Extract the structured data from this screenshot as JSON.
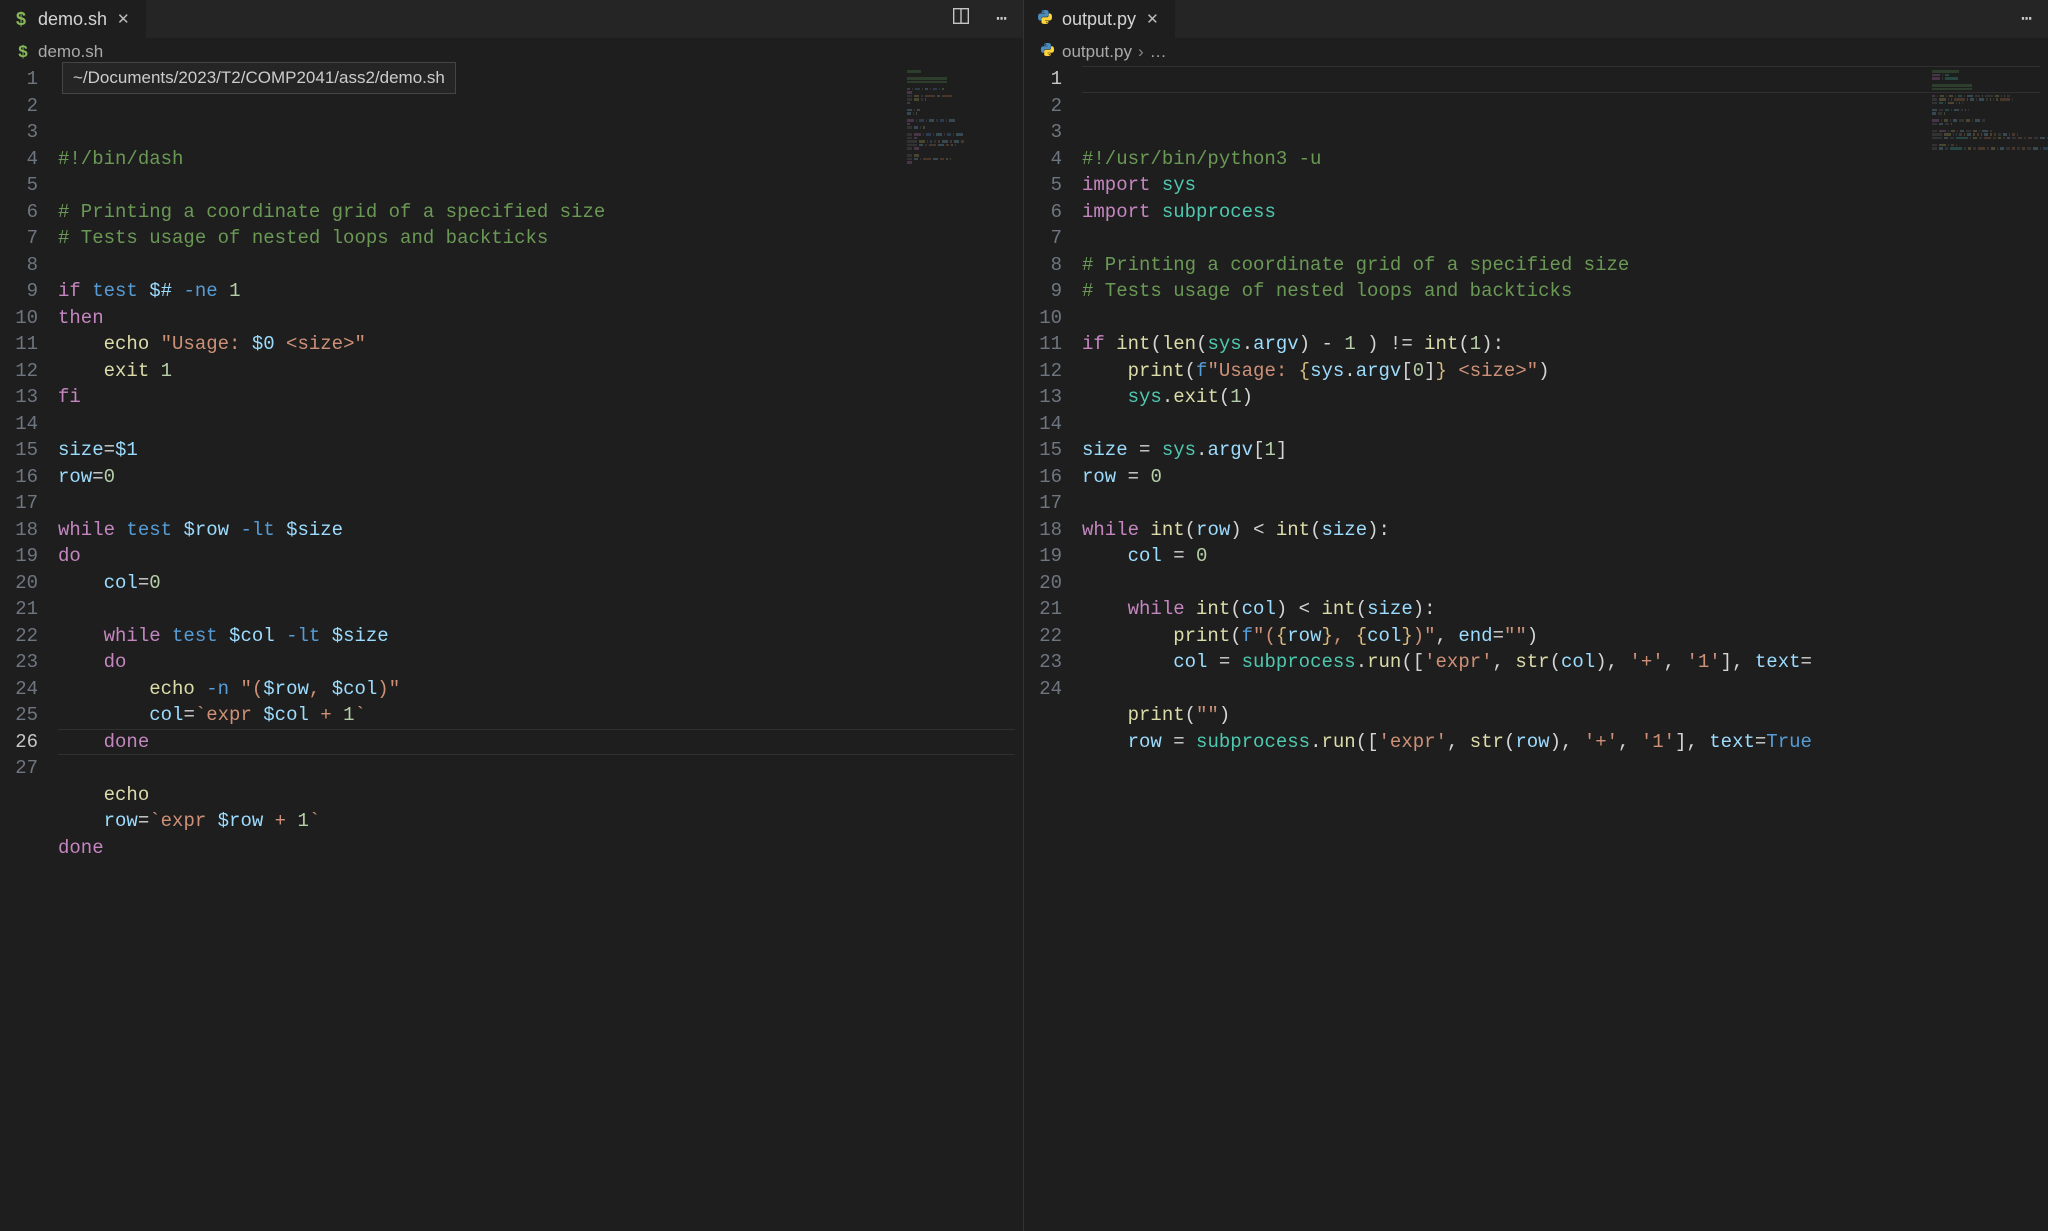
{
  "left": {
    "tab": {
      "filename": "demo.sh",
      "icon": "$"
    },
    "breadcrumb": {
      "filename": "demo.sh",
      "icon": "$"
    },
    "tooltip": "~/Documents/2023/T2/COMP2041/ass2/demo.sh",
    "active_line": 26,
    "code": [
      [
        {
          "c": "com",
          "t": "#!/bin/dash"
        }
      ],
      [],
      [
        {
          "c": "com",
          "t": "# Printing a coordinate grid of a specified size"
        }
      ],
      [
        {
          "c": "com",
          "t": "# Tests usage of nested loops and backticks"
        }
      ],
      [],
      [
        {
          "c": "kw",
          "t": "if"
        },
        {
          "c": "op",
          "t": " "
        },
        {
          "c": "cmd",
          "t": "test"
        },
        {
          "c": "op",
          "t": " "
        },
        {
          "c": "var",
          "t": "$#"
        },
        {
          "c": "op",
          "t": " "
        },
        {
          "c": "flag",
          "t": "-ne"
        },
        {
          "c": "op",
          "t": " "
        },
        {
          "c": "num",
          "t": "1"
        }
      ],
      [
        {
          "c": "kw",
          "t": "then"
        }
      ],
      [
        {
          "c": "op",
          "t": "    "
        },
        {
          "c": "fn",
          "t": "echo"
        },
        {
          "c": "op",
          "t": " "
        },
        {
          "c": "str",
          "t": "\"Usage: "
        },
        {
          "c": "var",
          "t": "$0"
        },
        {
          "c": "str",
          "t": " <size>\""
        }
      ],
      [
        {
          "c": "op",
          "t": "    "
        },
        {
          "c": "fn",
          "t": "exit"
        },
        {
          "c": "op",
          "t": " "
        },
        {
          "c": "num",
          "t": "1"
        }
      ],
      [
        {
          "c": "kw",
          "t": "fi"
        }
      ],
      [],
      [
        {
          "c": "var",
          "t": "size"
        },
        {
          "c": "op",
          "t": "="
        },
        {
          "c": "var",
          "t": "$1"
        }
      ],
      [
        {
          "c": "var",
          "t": "row"
        },
        {
          "c": "op",
          "t": "="
        },
        {
          "c": "num",
          "t": "0"
        }
      ],
      [],
      [
        {
          "c": "kw",
          "t": "while"
        },
        {
          "c": "op",
          "t": " "
        },
        {
          "c": "cmd",
          "t": "test"
        },
        {
          "c": "op",
          "t": " "
        },
        {
          "c": "var",
          "t": "$row"
        },
        {
          "c": "op",
          "t": " "
        },
        {
          "c": "flag",
          "t": "-lt"
        },
        {
          "c": "op",
          "t": " "
        },
        {
          "c": "var",
          "t": "$size"
        }
      ],
      [
        {
          "c": "kw",
          "t": "do"
        }
      ],
      [
        {
          "c": "op",
          "t": "    "
        },
        {
          "c": "var",
          "t": "col"
        },
        {
          "c": "op",
          "t": "="
        },
        {
          "c": "num",
          "t": "0"
        }
      ],
      [],
      [
        {
          "c": "op",
          "t": "    "
        },
        {
          "c": "kw",
          "t": "while"
        },
        {
          "c": "op",
          "t": " "
        },
        {
          "c": "cmd",
          "t": "test"
        },
        {
          "c": "op",
          "t": " "
        },
        {
          "c": "var",
          "t": "$col"
        },
        {
          "c": "op",
          "t": " "
        },
        {
          "c": "flag",
          "t": "-lt"
        },
        {
          "c": "op",
          "t": " "
        },
        {
          "c": "var",
          "t": "$size"
        }
      ],
      [
        {
          "c": "op",
          "t": "    "
        },
        {
          "c": "kw",
          "t": "do"
        }
      ],
      [
        {
          "c": "op",
          "t": "        "
        },
        {
          "c": "fn",
          "t": "echo"
        },
        {
          "c": "op",
          "t": " "
        },
        {
          "c": "flag",
          "t": "-n"
        },
        {
          "c": "op",
          "t": " "
        },
        {
          "c": "str",
          "t": "\"("
        },
        {
          "c": "var",
          "t": "$row"
        },
        {
          "c": "str",
          "t": ", "
        },
        {
          "c": "var",
          "t": "$col"
        },
        {
          "c": "str",
          "t": ")\""
        }
      ],
      [
        {
          "c": "op",
          "t": "        "
        },
        {
          "c": "var",
          "t": "col"
        },
        {
          "c": "op",
          "t": "="
        },
        {
          "c": "str",
          "t": "`expr "
        },
        {
          "c": "var",
          "t": "$col"
        },
        {
          "c": "str",
          "t": " + "
        },
        {
          "c": "num",
          "t": "1"
        },
        {
          "c": "str",
          "t": "`"
        }
      ],
      [
        {
          "c": "op",
          "t": "    "
        },
        {
          "c": "kw",
          "t": "done"
        }
      ],
      [],
      [
        {
          "c": "op",
          "t": "    "
        },
        {
          "c": "fn",
          "t": "echo"
        }
      ],
      [
        {
          "c": "op",
          "t": "    "
        },
        {
          "c": "var",
          "t": "row"
        },
        {
          "c": "op",
          "t": "="
        },
        {
          "c": "str",
          "t": "`expr "
        },
        {
          "c": "var",
          "t": "$row"
        },
        {
          "c": "str",
          "t": " + "
        },
        {
          "c": "num",
          "t": "1"
        },
        {
          "c": "str",
          "t": "`"
        }
      ],
      [
        {
          "c": "kw",
          "t": "done"
        }
      ]
    ]
  },
  "right": {
    "tab": {
      "filename": "output.py",
      "icon": "py"
    },
    "breadcrumb": {
      "filename": "output.py",
      "icon": "py",
      "trail": "…"
    },
    "active_line": 1,
    "code": [
      [
        {
          "c": "com",
          "t": "#!/usr/bin/python3 -u"
        }
      ],
      [
        {
          "c": "kw",
          "t": "import"
        },
        {
          "c": "op",
          "t": " "
        },
        {
          "c": "mod",
          "t": "sys"
        }
      ],
      [
        {
          "c": "kw",
          "t": "import"
        },
        {
          "c": "op",
          "t": " "
        },
        {
          "c": "mod",
          "t": "subprocess"
        }
      ],
      [],
      [
        {
          "c": "com",
          "t": "# Printing a coordinate grid of a specified size"
        }
      ],
      [
        {
          "c": "com",
          "t": "# Tests usage of nested loops and backticks"
        }
      ],
      [],
      [
        {
          "c": "kw",
          "t": "if"
        },
        {
          "c": "op",
          "t": " "
        },
        {
          "c": "fn",
          "t": "int"
        },
        {
          "c": "op",
          "t": "("
        },
        {
          "c": "fn",
          "t": "len"
        },
        {
          "c": "op",
          "t": "("
        },
        {
          "c": "mod",
          "t": "sys"
        },
        {
          "c": "op",
          "t": "."
        },
        {
          "c": "var",
          "t": "argv"
        },
        {
          "c": "op",
          "t": ") - "
        },
        {
          "c": "num",
          "t": "1"
        },
        {
          "c": "op",
          "t": " ) != "
        },
        {
          "c": "fn",
          "t": "int"
        },
        {
          "c": "op",
          "t": "("
        },
        {
          "c": "num",
          "t": "1"
        },
        {
          "c": "op",
          "t": "):"
        }
      ],
      [
        {
          "c": "op",
          "t": "    "
        },
        {
          "c": "fn",
          "t": "print"
        },
        {
          "c": "op",
          "t": "("
        },
        {
          "c": "cmd",
          "t": "f"
        },
        {
          "c": "str",
          "t": "\"Usage: "
        },
        {
          "c": "escape",
          "t": "{"
        },
        {
          "c": "var",
          "t": "sys"
        },
        {
          "c": "op",
          "t": "."
        },
        {
          "c": "var",
          "t": "argv"
        },
        {
          "c": "op",
          "t": "["
        },
        {
          "c": "num",
          "t": "0"
        },
        {
          "c": "op",
          "t": "]"
        },
        {
          "c": "escape",
          "t": "}"
        },
        {
          "c": "str",
          "t": " <size>\""
        },
        {
          "c": "op",
          "t": ")"
        }
      ],
      [
        {
          "c": "op",
          "t": "    "
        },
        {
          "c": "mod",
          "t": "sys"
        },
        {
          "c": "op",
          "t": "."
        },
        {
          "c": "fn",
          "t": "exit"
        },
        {
          "c": "op",
          "t": "("
        },
        {
          "c": "num",
          "t": "1"
        },
        {
          "c": "op",
          "t": ")"
        }
      ],
      [],
      [
        {
          "c": "var",
          "t": "size"
        },
        {
          "c": "op",
          "t": " = "
        },
        {
          "c": "mod",
          "t": "sys"
        },
        {
          "c": "op",
          "t": "."
        },
        {
          "c": "var",
          "t": "argv"
        },
        {
          "c": "op",
          "t": "["
        },
        {
          "c": "num",
          "t": "1"
        },
        {
          "c": "op",
          "t": "]"
        }
      ],
      [
        {
          "c": "var",
          "t": "row"
        },
        {
          "c": "op",
          "t": " = "
        },
        {
          "c": "num",
          "t": "0"
        }
      ],
      [],
      [
        {
          "c": "kw",
          "t": "while"
        },
        {
          "c": "op",
          "t": " "
        },
        {
          "c": "fn",
          "t": "int"
        },
        {
          "c": "op",
          "t": "("
        },
        {
          "c": "var",
          "t": "row"
        },
        {
          "c": "op",
          "t": ") < "
        },
        {
          "c": "fn",
          "t": "int"
        },
        {
          "c": "op",
          "t": "("
        },
        {
          "c": "var",
          "t": "size"
        },
        {
          "c": "op",
          "t": "):"
        }
      ],
      [
        {
          "c": "op",
          "t": "    "
        },
        {
          "c": "var",
          "t": "col"
        },
        {
          "c": "op",
          "t": " = "
        },
        {
          "c": "num",
          "t": "0"
        }
      ],
      [],
      [
        {
          "c": "op",
          "t": "    "
        },
        {
          "c": "kw",
          "t": "while"
        },
        {
          "c": "op",
          "t": " "
        },
        {
          "c": "fn",
          "t": "int"
        },
        {
          "c": "op",
          "t": "("
        },
        {
          "c": "var",
          "t": "col"
        },
        {
          "c": "op",
          "t": ") < "
        },
        {
          "c": "fn",
          "t": "int"
        },
        {
          "c": "op",
          "t": "("
        },
        {
          "c": "var",
          "t": "size"
        },
        {
          "c": "op",
          "t": "):"
        }
      ],
      [
        {
          "c": "op",
          "t": "        "
        },
        {
          "c": "fn",
          "t": "print"
        },
        {
          "c": "op",
          "t": "("
        },
        {
          "c": "cmd",
          "t": "f"
        },
        {
          "c": "str",
          "t": "\"("
        },
        {
          "c": "escape",
          "t": "{"
        },
        {
          "c": "var",
          "t": "row"
        },
        {
          "c": "escape",
          "t": "}"
        },
        {
          "c": "str",
          "t": ", "
        },
        {
          "c": "escape",
          "t": "{"
        },
        {
          "c": "var",
          "t": "col"
        },
        {
          "c": "escape",
          "t": "}"
        },
        {
          "c": "str",
          "t": ")\""
        },
        {
          "c": "op",
          "t": ", "
        },
        {
          "c": "param",
          "t": "end"
        },
        {
          "c": "op",
          "t": "="
        },
        {
          "c": "str",
          "t": "\"\""
        },
        {
          "c": "op",
          "t": ")"
        }
      ],
      [
        {
          "c": "op",
          "t": "        "
        },
        {
          "c": "var",
          "t": "col"
        },
        {
          "c": "op",
          "t": " = "
        },
        {
          "c": "mod",
          "t": "subprocess"
        },
        {
          "c": "op",
          "t": "."
        },
        {
          "c": "fn",
          "t": "run"
        },
        {
          "c": "op",
          "t": "(["
        },
        {
          "c": "str",
          "t": "'expr'"
        },
        {
          "c": "op",
          "t": ", "
        },
        {
          "c": "fn",
          "t": "str"
        },
        {
          "c": "op",
          "t": "("
        },
        {
          "c": "var",
          "t": "col"
        },
        {
          "c": "op",
          "t": "), "
        },
        {
          "c": "str",
          "t": "'+'"
        },
        {
          "c": "op",
          "t": ", "
        },
        {
          "c": "str",
          "t": "'1'"
        },
        {
          "c": "op",
          "t": "], "
        },
        {
          "c": "param",
          "t": "text"
        },
        {
          "c": "op",
          "t": "="
        }
      ],
      [],
      [
        {
          "c": "op",
          "t": "    "
        },
        {
          "c": "fn",
          "t": "print"
        },
        {
          "c": "op",
          "t": "("
        },
        {
          "c": "str",
          "t": "\"\""
        },
        {
          "c": "op",
          "t": ")"
        }
      ],
      [
        {
          "c": "op",
          "t": "    "
        },
        {
          "c": "var",
          "t": "row"
        },
        {
          "c": "op",
          "t": " = "
        },
        {
          "c": "mod",
          "t": "subprocess"
        },
        {
          "c": "op",
          "t": "."
        },
        {
          "c": "fn",
          "t": "run"
        },
        {
          "c": "op",
          "t": "(["
        },
        {
          "c": "str",
          "t": "'expr'"
        },
        {
          "c": "op",
          "t": ", "
        },
        {
          "c": "fn",
          "t": "str"
        },
        {
          "c": "op",
          "t": "("
        },
        {
          "c": "var",
          "t": "row"
        },
        {
          "c": "op",
          "t": "), "
        },
        {
          "c": "str",
          "t": "'+'"
        },
        {
          "c": "op",
          "t": ", "
        },
        {
          "c": "str",
          "t": "'1'"
        },
        {
          "c": "op",
          "t": "], "
        },
        {
          "c": "param",
          "t": "text"
        },
        {
          "c": "op",
          "t": "="
        },
        {
          "c": "cmd",
          "t": "True"
        }
      ],
      []
    ]
  },
  "mm_palette": {
    "com": "#3b5a38",
    "kw": "#6b4a6b",
    "cmd": "#335877",
    "str": "#6b4a3a",
    "var": "#4f6b7a",
    "num": "#5b6b50",
    "op": "#444",
    "fn": "#6b6640",
    "flag": "#335877",
    "mod": "#2f6b60",
    "param": "#4f6b7a",
    "escape": "#6b5f3c"
  }
}
